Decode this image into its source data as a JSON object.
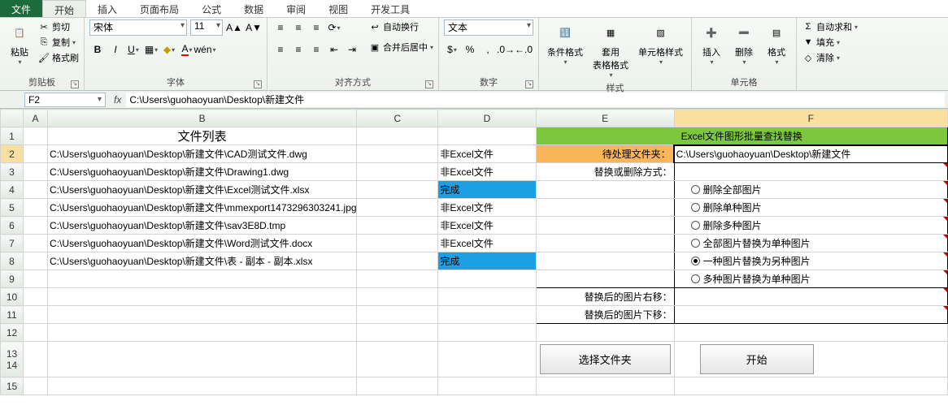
{
  "tabs": {
    "file": "文件",
    "start": "开始",
    "insert": "插入",
    "layout": "页面布局",
    "formula": "公式",
    "data": "数据",
    "review": "审阅",
    "view": "视图",
    "dev": "开发工具"
  },
  "ribbon": {
    "clipboard": {
      "paste": "粘贴",
      "cut": "剪切",
      "copy": "复制",
      "formatpainter": "格式刷",
      "label": "剪贴板"
    },
    "font": {
      "name": "宋体",
      "size": "11",
      "label": "字体"
    },
    "align": {
      "wrap": "自动换行",
      "merge": "合并后居中",
      "label": "对齐方式"
    },
    "number": {
      "format": "文本",
      "label": "数字"
    },
    "style": {
      "cond": "条件格式",
      "table": "套用\n表格格式",
      "cell": "单元格样式",
      "label": "样式"
    },
    "cells": {
      "insert": "插入",
      "delete": "删除",
      "format": "格式",
      "label": "单元格"
    },
    "editing": {
      "sum": "自动求和",
      "fill": "填充",
      "clear": "清除"
    }
  },
  "formulabar": {
    "cell": "F2",
    "value": "C:\\Users\\guohaoyuan\\Desktop\\新建文件"
  },
  "columns": [
    "A",
    "B",
    "C",
    "D",
    "E",
    "F"
  ],
  "sheet": {
    "b1": "文件列表",
    "e_f_1": "Excel文件图形批量查找替换",
    "rows": [
      {
        "b": "C:\\Users\\guohaoyuan\\Desktop\\新建文件\\CAD测试文件.dwg",
        "d": "非Excel文件",
        "e": "待处理文件夹：",
        "f": "C:\\Users\\guohaoyuan\\Desktop\\新建文件"
      },
      {
        "b": "C:\\Users\\guohaoyuan\\Desktop\\新建文件\\Drawing1.dwg",
        "d": "非Excel文件",
        "e": "替换或删除方式：",
        "f": ""
      },
      {
        "b": "C:\\Users\\guohaoyuan\\Desktop\\新建文件\\Excel测试文件.xlsx",
        "d": "完成",
        "e": "",
        "f_radio": "删除全部图片"
      },
      {
        "b": "C:\\Users\\guohaoyuan\\Desktop\\新建文件\\mmexport1473296303241.jpg",
        "d": "非Excel文件",
        "e": "",
        "f_radio": "删除单种图片"
      },
      {
        "b": "C:\\Users\\guohaoyuan\\Desktop\\新建文件\\sav3E8D.tmp",
        "d": "非Excel文件",
        "e": "",
        "f_radio": "删除多种图片"
      },
      {
        "b": "C:\\Users\\guohaoyuan\\Desktop\\新建文件\\Word测试文件.docx",
        "d": "非Excel文件",
        "e": "",
        "f_radio": "全部图片替换为单种图片"
      },
      {
        "b": "C:\\Users\\guohaoyuan\\Desktop\\新建文件\\表 - 副本 - 副本.xlsx",
        "d": "完成",
        "e": "",
        "f_radio": "一种图片替换为另种图片",
        "checked": true
      },
      {
        "b": "",
        "d": "",
        "e": "",
        "f_radio": "多种图片替换为单种图片"
      },
      {
        "b": "",
        "d": "",
        "e": "替换后的图片右移：",
        "f": ""
      },
      {
        "b": "",
        "d": "",
        "e": "替换后的图片下移：",
        "f": ""
      }
    ],
    "btn_folder": "选择文件夹",
    "btn_start": "开始"
  }
}
